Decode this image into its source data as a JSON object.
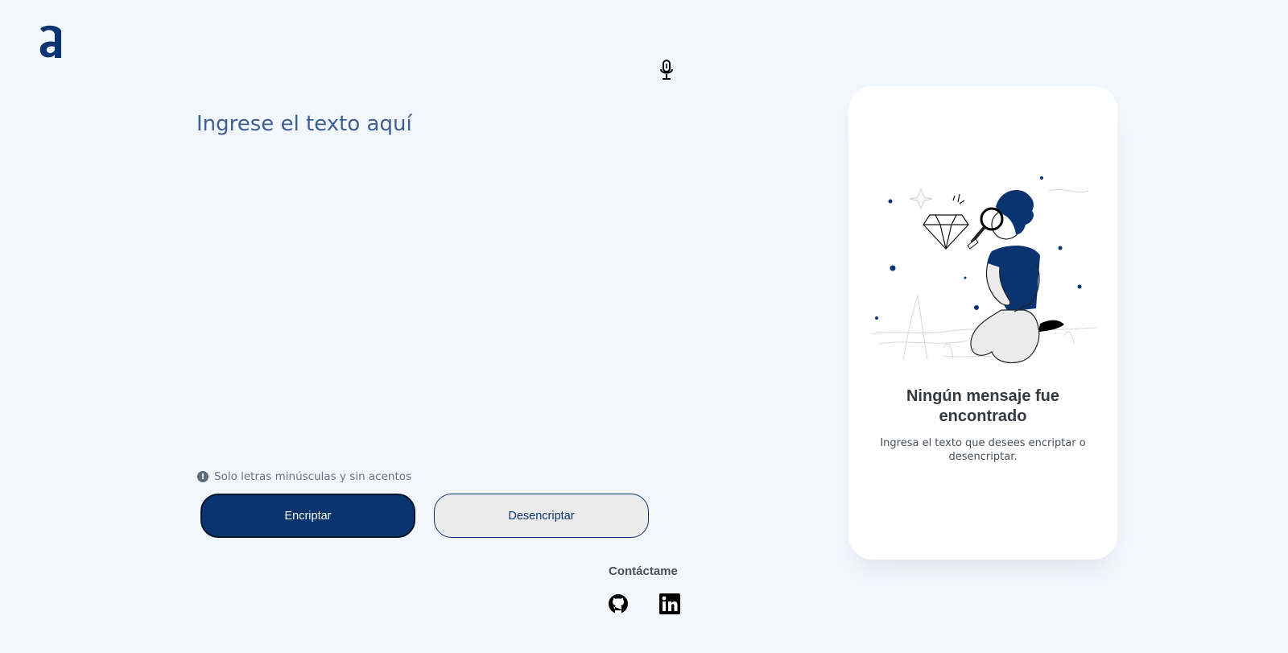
{
  "header": {
    "logo_icon": "alura-a-logo-icon",
    "mic_icon": "microphone-icon"
  },
  "input": {
    "placeholder": "Ingrese el texto aquí",
    "value": ""
  },
  "hint": {
    "icon": "exclamation-circle-icon",
    "text": "Solo letras minúsculas y sin acentos"
  },
  "actions": {
    "encrypt_label": "Encriptar",
    "decrypt_label": "Desencriptar"
  },
  "footer": {
    "contact_title": "Contáctame",
    "github_icon": "github-icon",
    "linkedin_icon": "linkedin-icon"
  },
  "output": {
    "title": "Ningún mensaje fue encontrado",
    "subtitle": "Ingresa el texto que desees encriptar o desencriptar."
  },
  "colors": {
    "background": "#f2f6fd",
    "primary": "#0a3470",
    "card": "#ffffff",
    "placeholder": "#3e5f91"
  }
}
